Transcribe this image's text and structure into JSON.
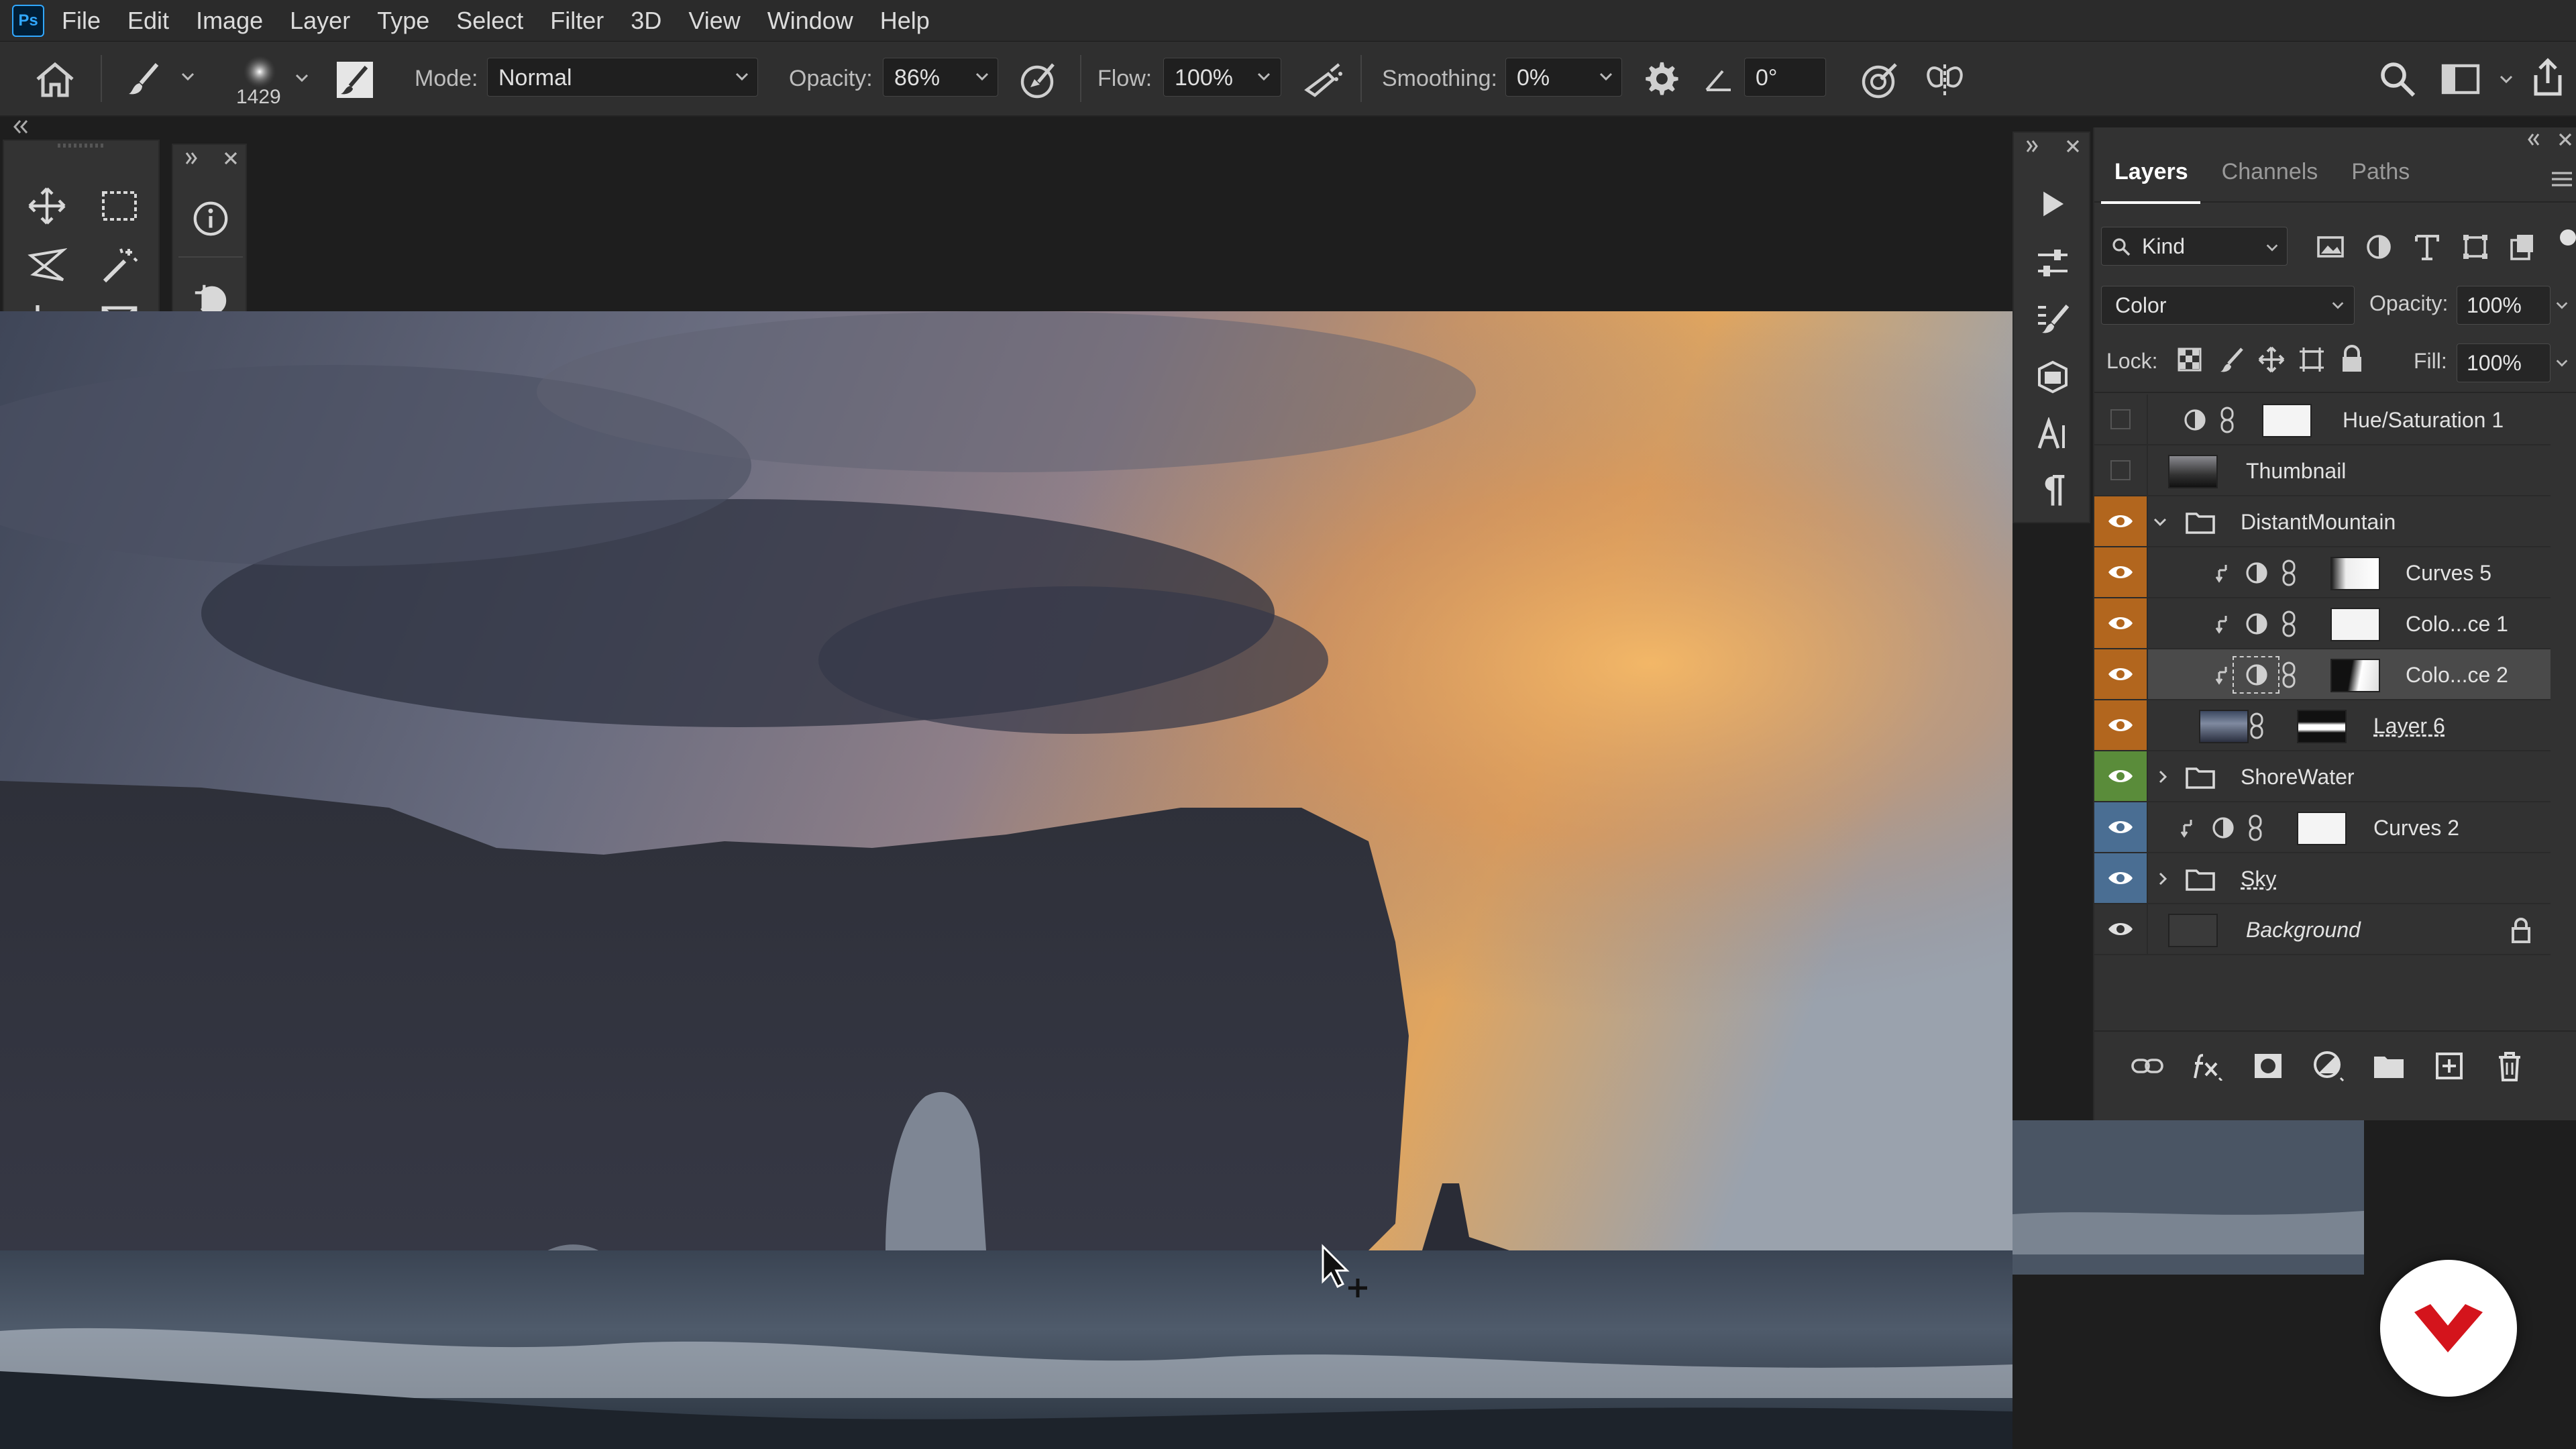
{
  "app": {
    "logo": "Ps"
  },
  "menu": [
    "File",
    "Edit",
    "Image",
    "Layer",
    "Type",
    "Select",
    "Filter",
    "3D",
    "View",
    "Window",
    "Help"
  ],
  "options_bar": {
    "brush_size": "1429",
    "mode_label": "Mode:",
    "mode_value": "Normal",
    "opacity_label": "Opacity:",
    "opacity_value": "86%",
    "flow_label": "Flow:",
    "flow_value": "100%",
    "smoothing_label": "Smoothing:",
    "smoothing_value": "0%",
    "angle_value": "0°",
    "icons": [
      "home-icon",
      "brush-tool-icon",
      "brush-preset-icon",
      "brush-settings-icon",
      "pressure-opacity-icon",
      "airbrush-icon",
      "gear-icon",
      "angle-icon",
      "pressure-size-icon",
      "symmetry-icon",
      "search-icon",
      "workspace-icon",
      "share-icon"
    ]
  },
  "tools": [
    "move-tool",
    "marquee-tool",
    "lasso-tool",
    "magic-wand-tool",
    "crop-tool",
    "frame-tool",
    "eyedropper-tool",
    "healing-brush-tool",
    "brush-tool",
    "clone-stamp-tool",
    "history-brush-tool",
    "eraser-tool",
    "gradient-tool",
    "blur-tool",
    "dodge-tool",
    "pen-tool",
    "type-tool",
    "path-selection-tool",
    "shape-tool",
    "hand-tool",
    "zoom-tool",
    "more-tools",
    "foreground-color",
    "background-color",
    "quick-mask",
    "screen-mode"
  ],
  "colors": {
    "foreground": "#3b4b60",
    "background": "#2f2f2f",
    "accent_orange": "#b2661e",
    "accent_green": "#5a8c3a",
    "accent_blue": "#4a6e93"
  },
  "layers_panel": {
    "tabs": [
      "Layers",
      "Channels",
      "Paths"
    ],
    "active_tab": "Layers",
    "filter_kind": "Kind",
    "blend_mode": "Color",
    "opacity_label": "Opacity:",
    "opacity_value": "100%",
    "lock_label": "Lock:",
    "fill_label": "Fill:",
    "fill_value": "100%",
    "layers": [
      {
        "name": "Hue/Saturation 1",
        "visible": false,
        "kind": "adjustment"
      },
      {
        "name": "Thumbnail",
        "visible": false,
        "kind": "image"
      },
      {
        "name": "DistantMountain",
        "visible": true,
        "kind": "group",
        "color": "orange",
        "expanded": true
      },
      {
        "name": "Curves 5",
        "visible": true,
        "kind": "adjustment",
        "clipped": true,
        "color": "orange"
      },
      {
        "name": "Colo...ce 1",
        "visible": true,
        "kind": "adjustment",
        "clipped": true,
        "color": "orange"
      },
      {
        "name": "Colo...ce 2",
        "visible": true,
        "kind": "adjustment",
        "clipped": true,
        "color": "orange",
        "selected": true
      },
      {
        "name": "Layer 6",
        "visible": true,
        "kind": "image-mask",
        "color": "orange"
      },
      {
        "name": "ShoreWater",
        "visible": true,
        "kind": "group",
        "color": "green",
        "expanded": false
      },
      {
        "name": "Curves 2",
        "visible": true,
        "kind": "adjustment",
        "clipped": true,
        "color": "blue"
      },
      {
        "name": "Sky",
        "visible": true,
        "kind": "group",
        "color": "blue",
        "expanded": false
      },
      {
        "name": "Background",
        "visible": true,
        "kind": "background",
        "locked": true
      }
    ],
    "footer_icons": [
      "link-icon",
      "fx-icon",
      "mask-icon",
      "adjustment-icon",
      "folder-icon",
      "new-layer-icon",
      "trash-icon"
    ]
  }
}
